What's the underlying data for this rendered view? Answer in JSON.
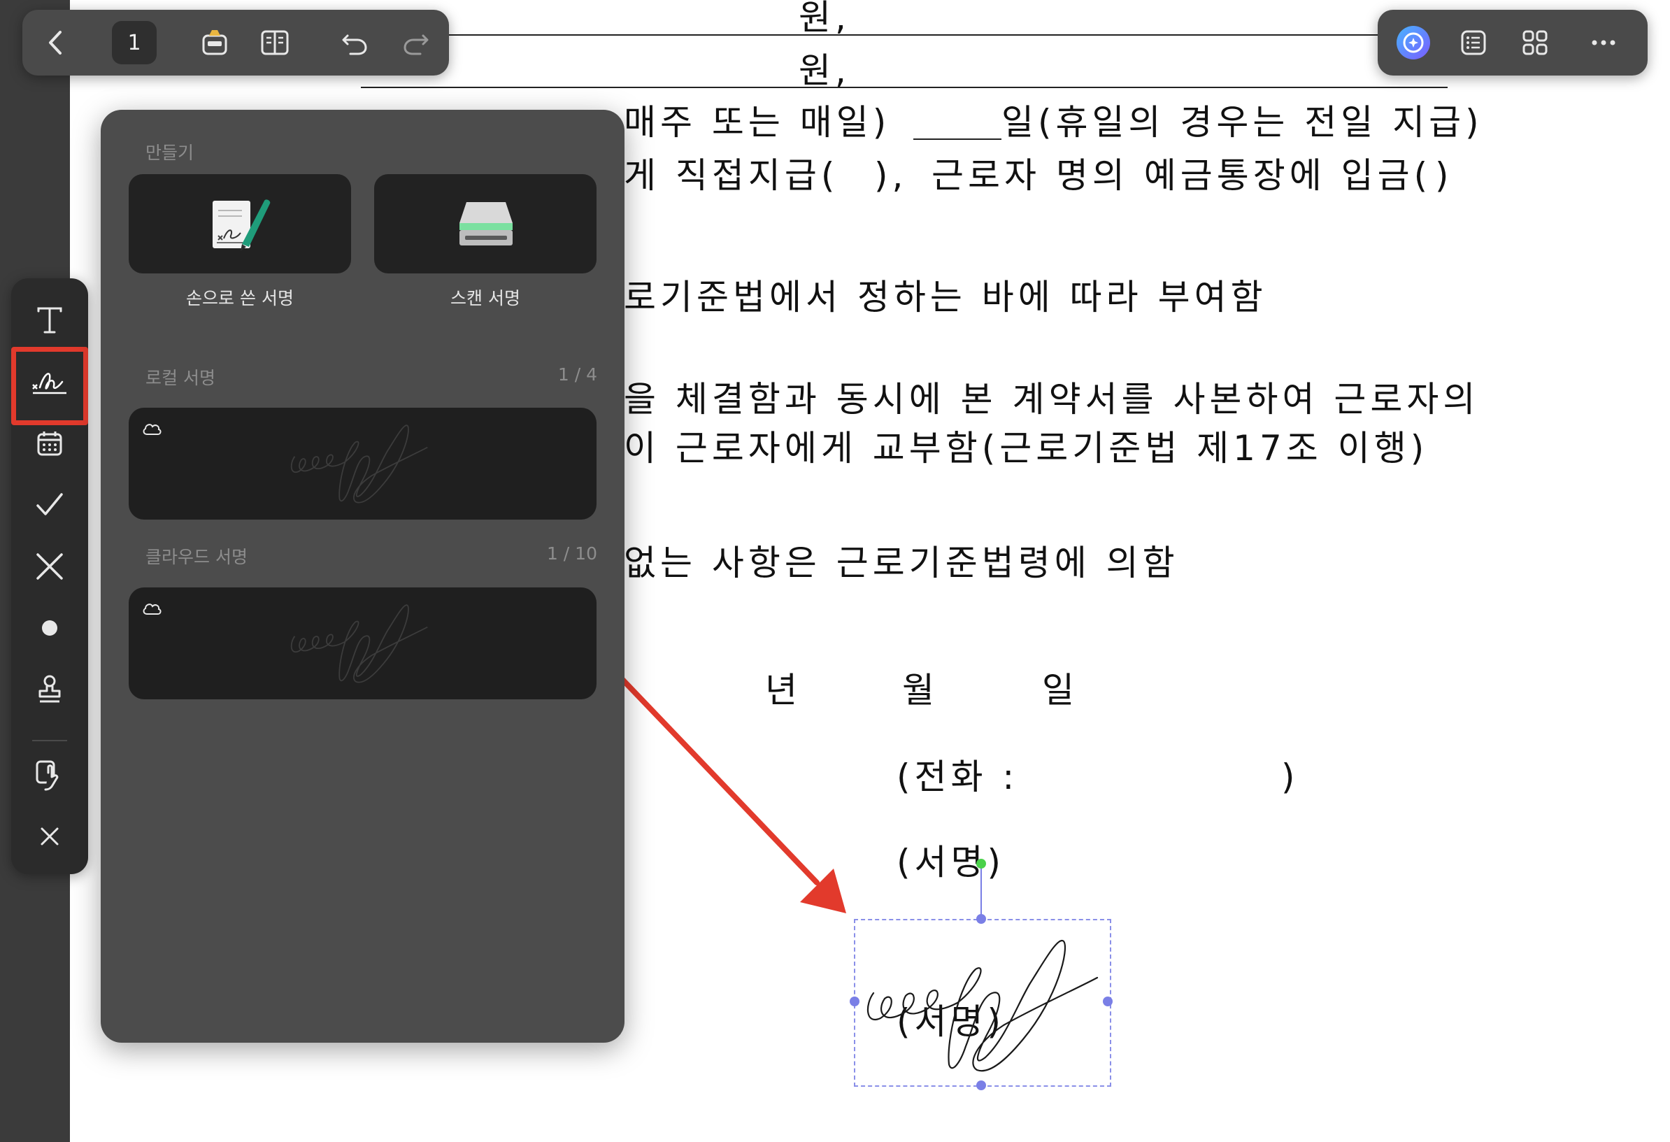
{
  "toolbar_left": {
    "back_icon": "chevron-left-icon",
    "page_number": "1",
    "icons": [
      "sticker-icon",
      "book-view-icon",
      "undo-icon",
      "redo-icon"
    ]
  },
  "toolbar_right": {
    "icons": [
      "ai-assistant-icon",
      "outline-list-icon",
      "grid-icon",
      "more-icon"
    ]
  },
  "document": {
    "line1": "원,",
    "line2": "원,",
    "pay_day": "매주 또는 매일)",
    "pay_day_rest": "일(휴일의 경우는 전일 지급)",
    "pay_method": "게 직접지급(",
    "pay_method_close": "),",
    "pay_method_rest": "근로자 명의 예금통장에 입금(",
    "pay_method_end": ")",
    "leave": "로기준법에서 정하는 바에 따라 부여함",
    "copy1": "을 체결함과 동시에 본 계약서를 사본하여 근로자의",
    "copy2": "이 근로자에게 교부함(근로기준법 제17조 이행)",
    "others": "없는 사항은 근로기준법령에 의함",
    "year": "년",
    "month": "월",
    "day": "일",
    "phone": "(전화 :",
    "phone_close": ")",
    "sign1": "(서명)",
    "sign2": "(서명)"
  },
  "sidebar": {
    "tools": [
      "text-tool-icon",
      "signature-tool-icon",
      "date-tool-icon",
      "checkmark-tool-icon",
      "cross-tool-icon",
      "dot-tool-icon",
      "stamp-tool-icon",
      "hand-tool-icon",
      "close-icon"
    ]
  },
  "panel": {
    "create_label": "만들기",
    "handwritten_label": "손으로 쓴 서명",
    "scan_label": "스캔 서명",
    "local_label": "로컬 서명",
    "local_count": "1 / 4",
    "cloud_label": "클라우드 서명",
    "cloud_count": "1 / 10"
  },
  "colors": {
    "highlight": "#e23a2c",
    "arrow": "#e23a2c",
    "selection": "#7a7fe6",
    "panel_bg": "#4c4c4c"
  }
}
